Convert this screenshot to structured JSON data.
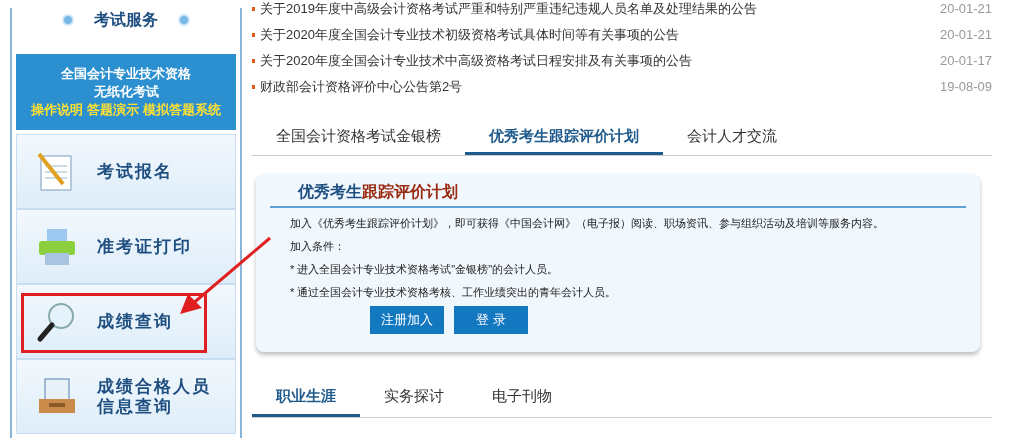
{
  "sidebar": {
    "title": "考试服务",
    "banner": {
      "line1": "全国会计专业技术资格",
      "line2": "无纸化考试",
      "links": [
        "操作说明",
        "答题演示",
        "模拟答题系统"
      ]
    },
    "items": [
      {
        "kind": "notepad",
        "label": "考试报名",
        "highlighted": false
      },
      {
        "kind": "printer",
        "label": "准考证打印",
        "highlighted": false
      },
      {
        "kind": "magnifier",
        "label": "成绩查询",
        "highlighted": true
      },
      {
        "kind": "tray",
        "label": "成绩合格人员信息查询",
        "highlighted": false
      }
    ]
  },
  "news": [
    {
      "title": "关于2019年度中高级会计资格考试严重和特别严重违纪违规人员名单及处理结果的公告",
      "date": "20-01-21"
    },
    {
      "title": "关于2020年度全国会计专业技术初级资格考试具体时间等有关事项的公告",
      "date": "20-01-21"
    },
    {
      "title": "关于2020年度全国会计专业技术中高级资格考试日程安排及有关事项的公告",
      "date": "20-01-17"
    },
    {
      "title": "财政部会计资格评价中心公告第2号",
      "date": "19-08-09"
    }
  ],
  "tabs": [
    {
      "label": "全国会计资格考试金银榜",
      "selected": false
    },
    {
      "label": "优秀考生跟踪评价计划",
      "selected": true
    },
    {
      "label": "会计人才交流",
      "selected": false
    }
  ],
  "card": {
    "title_part1": "优秀考生",
    "title_part2": "跟踪评价计划",
    "lines": [
      "加入《优秀考生跟踪评价计划》，即可获得《中国会计网》（电子报）阅读、职场资讯、参与组织活动及培训等服务内容。",
      "加入条件：",
      "* 进入全国会计专业技术资格考试\"金银榜\"的会计人员。",
      "* 通过全国会计专业技术资格考核、工作业绩突出的青年会计人员。"
    ],
    "buttons": [
      "注册加入",
      "登 录"
    ]
  },
  "bottom_tabs": [
    {
      "label": "职业生涯",
      "selected": true
    },
    {
      "label": "实务探讨",
      "selected": false
    },
    {
      "label": "电子刊物",
      "selected": false
    }
  ]
}
